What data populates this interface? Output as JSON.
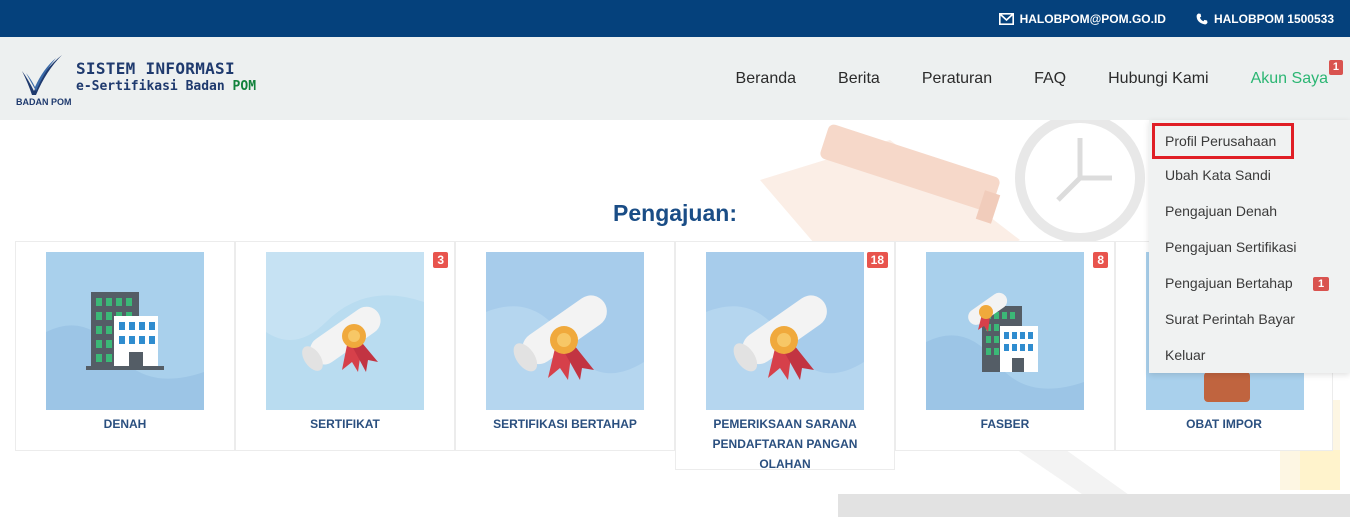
{
  "topbar": {
    "email": "HALOBPOM@POM.GO.ID",
    "phone": "HALOBPOM 1500533",
    "email_icon": "envelope-icon",
    "phone_icon": "phone-icon"
  },
  "logo": {
    "caption": "BADAN POM",
    "title": "SISTEM INFORMASI",
    "subtitle_prefix": "e-Sertifikasi Badan",
    "subtitle_brand": "POM"
  },
  "nav": {
    "items": [
      "Beranda",
      "Berita",
      "Peraturan",
      "FAQ",
      "Hubungi Kami"
    ],
    "account": "Akun Saya",
    "account_badge": "1"
  },
  "section": {
    "title": "Pengajuan:"
  },
  "cards": [
    {
      "label": "DENAH",
      "badge": "",
      "icon": "building-icon"
    },
    {
      "label": "SERTIFIKAT",
      "badge": "3",
      "icon": "certificate-icon"
    },
    {
      "label": "SERTIFIKASI BERTAHAP",
      "badge": "",
      "icon": "certificate-icon"
    },
    {
      "label": "PEMERIKSAAN SARANA PENDAFTARAN PANGAN OLAHAN",
      "badge": "18",
      "icon": "certificate-icon"
    },
    {
      "label": "FASBER",
      "badge": "8",
      "icon": "building-certificate-icon"
    },
    {
      "label": "OBAT IMPOR",
      "badge": "",
      "icon": "medicine-icon"
    }
  ],
  "dropdown": {
    "items": [
      "Profil Perusahaan",
      "Ubah Kata Sandi",
      "Pengajuan Denah",
      "Pengajuan Sertifikasi",
      "Pengajuan Bertahap",
      "Surat Perintah Bayar",
      "Keluar"
    ],
    "bertahap_badge": "1"
  },
  "colors": {
    "topbar": "#05417c",
    "accent_green": "#2bb673",
    "title_blue": "#1a4d86",
    "badge_red": "#e8544d",
    "highlight_red": "#e01e26"
  }
}
